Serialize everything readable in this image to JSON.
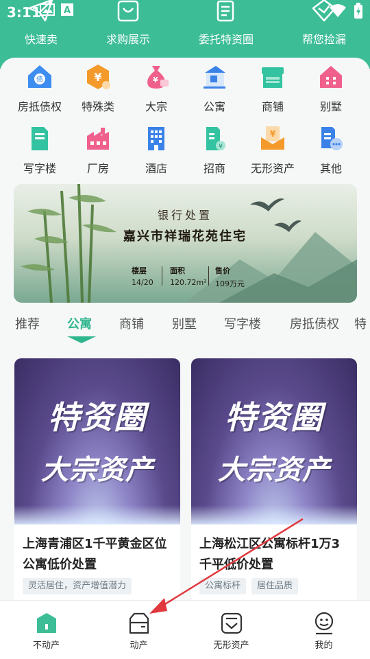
{
  "status_bar": {
    "time": "3:11"
  },
  "quick_nav": [
    {
      "label": "快速卖",
      "icon": "paper-plane-icon"
    },
    {
      "label": "求购展示",
      "icon": "shopping-bag-icon"
    },
    {
      "label": "委托特资圈",
      "icon": "document-icon"
    },
    {
      "label": "帮您捡漏",
      "icon": "shield-icon"
    }
  ],
  "categories": [
    {
      "label": "房抵债权",
      "icon": "house-mortgage-icon",
      "color": "#3d8ef0"
    },
    {
      "label": "特殊类",
      "icon": "yen-coin-icon",
      "color": "#f39a2b"
    },
    {
      "label": "大宗",
      "icon": "money-bag-icon",
      "color": "#f0608c"
    },
    {
      "label": "公寓",
      "icon": "apartment-icon",
      "color": "#3b82e8"
    },
    {
      "label": "商铺",
      "icon": "shop-icon",
      "color": "#34c3a1"
    },
    {
      "label": "别墅",
      "icon": "villa-icon",
      "color": "#f0608c"
    },
    {
      "label": "写字楼",
      "icon": "office-building-icon",
      "color": "#34c3a1"
    },
    {
      "label": "厂房",
      "icon": "factory-icon",
      "color": "#f0608c"
    },
    {
      "label": "酒店",
      "icon": "hotel-icon",
      "color": "#3b82e8"
    },
    {
      "label": "招商",
      "icon": "investment-icon",
      "color": "#34c3a1"
    },
    {
      "label": "无形资产",
      "icon": "intangible-asset-icon",
      "color": "#f39a2b"
    },
    {
      "label": "其他",
      "icon": "other-icon",
      "color": "#3b82e8"
    }
  ],
  "banner": {
    "subtitle": "银行处置",
    "title": "嘉兴市祥瑞花苑住宅",
    "stats": [
      {
        "key": "楼层",
        "value": "14/20"
      },
      {
        "key": "面积",
        "value": "120.72m²"
      },
      {
        "key": "售价",
        "value": "109万元"
      }
    ]
  },
  "tabs": [
    {
      "label": "推荐",
      "active": false
    },
    {
      "label": "公寓",
      "active": true
    },
    {
      "label": "商铺",
      "active": false
    },
    {
      "label": "别墅",
      "active": false
    },
    {
      "label": "写字楼",
      "active": false
    },
    {
      "label": "房抵债权",
      "active": false
    },
    {
      "label": "特",
      "active": false
    }
  ],
  "listings": [
    {
      "promo_line1": "特资圈",
      "promo_line2": "大宗资产",
      "title": "上海青浦区1千平黄金区位公寓低价处置",
      "tags": [
        "灵活居住，资产增值潜力"
      ]
    },
    {
      "promo_line1": "特资圈",
      "promo_line2": "大宗资产",
      "title": "上海松江区公寓标杆1万3千平低价处置",
      "tags": [
        "公寓标杆",
        "居住品质"
      ]
    }
  ],
  "bottom_nav": [
    {
      "label": "不动产",
      "icon": "real-estate-icon",
      "active": true
    },
    {
      "label": "动产",
      "icon": "box-icon",
      "active": false
    },
    {
      "label": "无形资产",
      "icon": "intangible-icon",
      "active": false
    },
    {
      "label": "我的",
      "icon": "profile-icon",
      "active": false
    }
  ],
  "colors": {
    "brand": "#3dbd96",
    "tab_active": "#2fb68d",
    "annotation": "#e0393e"
  }
}
